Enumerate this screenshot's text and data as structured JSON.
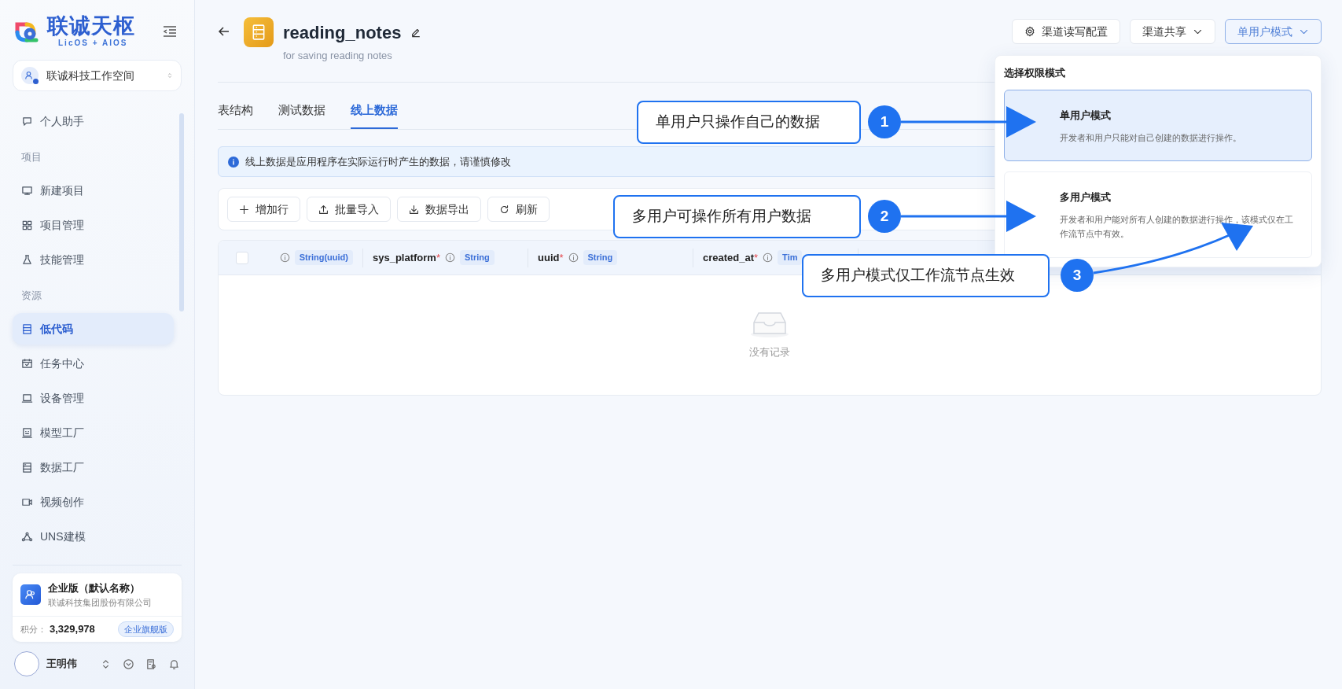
{
  "brand": {
    "name": "联诚天枢",
    "tagline": "LicOS + AIOS"
  },
  "workspace": {
    "name": "联诚科技工作空间"
  },
  "nav": [
    {
      "kind": "item",
      "label": "个人助手",
      "selected": false
    },
    {
      "kind": "section",
      "label": "项目"
    },
    {
      "kind": "item",
      "label": "新建项目",
      "selected": false
    },
    {
      "kind": "item",
      "label": "项目管理",
      "selected": false
    },
    {
      "kind": "item",
      "label": "技能管理",
      "selected": false
    },
    {
      "kind": "section",
      "label": "资源"
    },
    {
      "kind": "item",
      "label": "低代码",
      "selected": true
    },
    {
      "kind": "item",
      "label": "任务中心",
      "selected": false
    },
    {
      "kind": "item",
      "label": "设备管理",
      "selected": false
    },
    {
      "kind": "item",
      "label": "模型工厂",
      "selected": false
    },
    {
      "kind": "item",
      "label": "数据工厂",
      "selected": false
    },
    {
      "kind": "item",
      "label": "视频创作",
      "selected": false
    },
    {
      "kind": "item",
      "label": "UNS建模",
      "selected": false
    }
  ],
  "org_card": {
    "title": "企业版（默认名称）",
    "company": "联诚科技集团股份有限公司",
    "points_label": "积分：",
    "points": "3,329,978",
    "plan": "企业旗舰版"
  },
  "user": {
    "name": "王明伟"
  },
  "header": {
    "title": "reading_notes",
    "subtitle": "for saving reading notes",
    "buttons": [
      {
        "kind": "settings",
        "label": "渠道读写配置",
        "open": false
      },
      {
        "kind": "dropdown",
        "label": "渠道共享",
        "open": false
      },
      {
        "kind": "dropdown",
        "label": "单用户模式",
        "open": true
      }
    ]
  },
  "tabs": [
    {
      "label": "表结构",
      "selected": false
    },
    {
      "label": "测试数据",
      "selected": false
    },
    {
      "label": "线上数据",
      "selected": true
    }
  ],
  "notice": "线上数据是应用程序在实际运行时产生的数据，请谨慎修改",
  "toolbar": [
    {
      "kind": "add",
      "label": "增加行"
    },
    {
      "kind": "import",
      "label": "批量导入"
    },
    {
      "kind": "export",
      "label": "数据导出"
    },
    {
      "kind": "refresh",
      "label": "刷新"
    }
  ],
  "table": {
    "select_all": {
      "checked": false
    },
    "columns": [
      {
        "type": "String(uuid)"
      },
      {
        "name": "sys_platform",
        "mark": "*",
        "type": "String"
      },
      {
        "name": "uuid",
        "mark": "*",
        "type": "String"
      },
      {
        "name": "created_at",
        "mark": "*",
        "type": "Tim"
      }
    ],
    "empty_text": "没有记录"
  },
  "mode_menu": {
    "title": "选择权限模式",
    "options": [
      {
        "title": "单用户模式",
        "description": "开发者和用户只能对自己创建的数据进行操作。",
        "selected": true
      },
      {
        "title": "多用户模式",
        "description": "开发者和用户能对所有人创建的数据进行操作，该模式仅在工作流节点中有效。",
        "selected": false
      }
    ]
  },
  "callouts": [
    {
      "number": "1",
      "text": "单用户只操作自己的数据"
    },
    {
      "number": "2",
      "text": "多用户可操作所有用户数据"
    },
    {
      "number": "3",
      "text": "多用户模式仅工作流节点生效"
    }
  ]
}
